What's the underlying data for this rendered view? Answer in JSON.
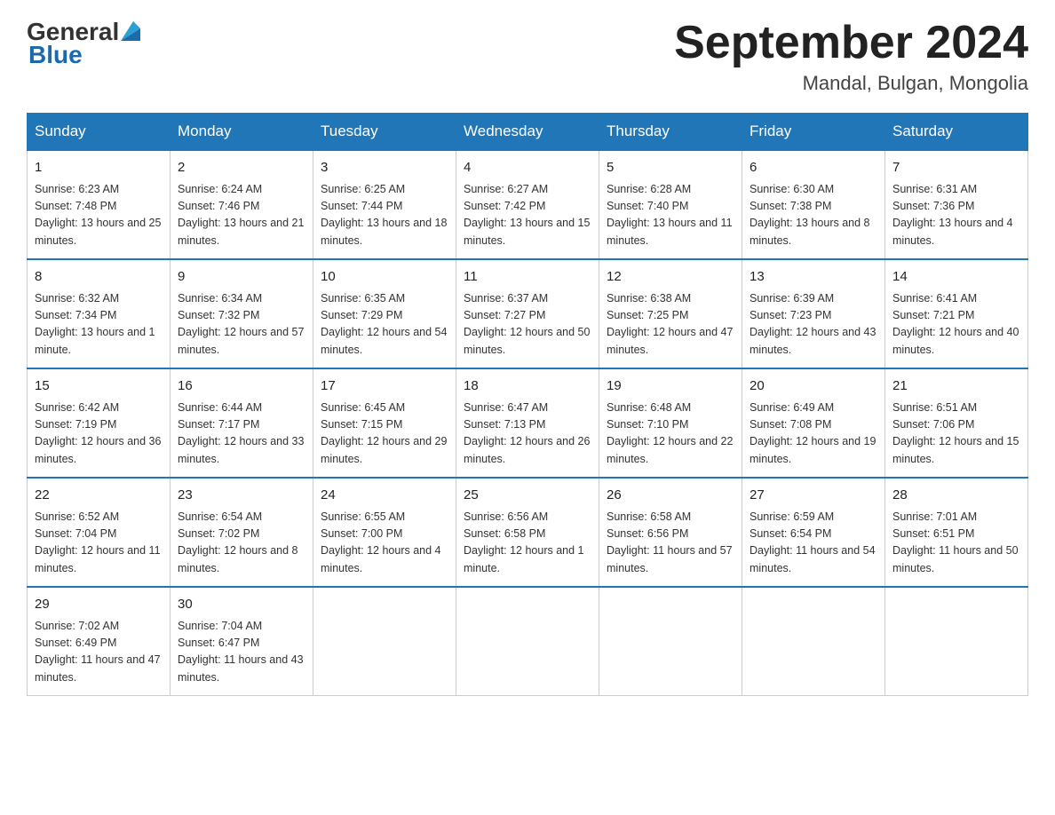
{
  "header": {
    "logo_general": "General",
    "logo_blue": "Blue",
    "month_title": "September 2024",
    "location": "Mandal, Bulgan, Mongolia"
  },
  "weekdays": [
    "Sunday",
    "Monday",
    "Tuesday",
    "Wednesday",
    "Thursday",
    "Friday",
    "Saturday"
  ],
  "weeks": [
    [
      {
        "day": "1",
        "sunrise": "6:23 AM",
        "sunset": "7:48 PM",
        "daylight": "13 hours and 25 minutes."
      },
      {
        "day": "2",
        "sunrise": "6:24 AM",
        "sunset": "7:46 PM",
        "daylight": "13 hours and 21 minutes."
      },
      {
        "day": "3",
        "sunrise": "6:25 AM",
        "sunset": "7:44 PM",
        "daylight": "13 hours and 18 minutes."
      },
      {
        "day": "4",
        "sunrise": "6:27 AM",
        "sunset": "7:42 PM",
        "daylight": "13 hours and 15 minutes."
      },
      {
        "day": "5",
        "sunrise": "6:28 AM",
        "sunset": "7:40 PM",
        "daylight": "13 hours and 11 minutes."
      },
      {
        "day": "6",
        "sunrise": "6:30 AM",
        "sunset": "7:38 PM",
        "daylight": "13 hours and 8 minutes."
      },
      {
        "day": "7",
        "sunrise": "6:31 AM",
        "sunset": "7:36 PM",
        "daylight": "13 hours and 4 minutes."
      }
    ],
    [
      {
        "day": "8",
        "sunrise": "6:32 AM",
        "sunset": "7:34 PM",
        "daylight": "13 hours and 1 minute."
      },
      {
        "day": "9",
        "sunrise": "6:34 AM",
        "sunset": "7:32 PM",
        "daylight": "12 hours and 57 minutes."
      },
      {
        "day": "10",
        "sunrise": "6:35 AM",
        "sunset": "7:29 PM",
        "daylight": "12 hours and 54 minutes."
      },
      {
        "day": "11",
        "sunrise": "6:37 AM",
        "sunset": "7:27 PM",
        "daylight": "12 hours and 50 minutes."
      },
      {
        "day": "12",
        "sunrise": "6:38 AM",
        "sunset": "7:25 PM",
        "daylight": "12 hours and 47 minutes."
      },
      {
        "day": "13",
        "sunrise": "6:39 AM",
        "sunset": "7:23 PM",
        "daylight": "12 hours and 43 minutes."
      },
      {
        "day": "14",
        "sunrise": "6:41 AM",
        "sunset": "7:21 PM",
        "daylight": "12 hours and 40 minutes."
      }
    ],
    [
      {
        "day": "15",
        "sunrise": "6:42 AM",
        "sunset": "7:19 PM",
        "daylight": "12 hours and 36 minutes."
      },
      {
        "day": "16",
        "sunrise": "6:44 AM",
        "sunset": "7:17 PM",
        "daylight": "12 hours and 33 minutes."
      },
      {
        "day": "17",
        "sunrise": "6:45 AM",
        "sunset": "7:15 PM",
        "daylight": "12 hours and 29 minutes."
      },
      {
        "day": "18",
        "sunrise": "6:47 AM",
        "sunset": "7:13 PM",
        "daylight": "12 hours and 26 minutes."
      },
      {
        "day": "19",
        "sunrise": "6:48 AM",
        "sunset": "7:10 PM",
        "daylight": "12 hours and 22 minutes."
      },
      {
        "day": "20",
        "sunrise": "6:49 AM",
        "sunset": "7:08 PM",
        "daylight": "12 hours and 19 minutes."
      },
      {
        "day": "21",
        "sunrise": "6:51 AM",
        "sunset": "7:06 PM",
        "daylight": "12 hours and 15 minutes."
      }
    ],
    [
      {
        "day": "22",
        "sunrise": "6:52 AM",
        "sunset": "7:04 PM",
        "daylight": "12 hours and 11 minutes."
      },
      {
        "day": "23",
        "sunrise": "6:54 AM",
        "sunset": "7:02 PM",
        "daylight": "12 hours and 8 minutes."
      },
      {
        "day": "24",
        "sunrise": "6:55 AM",
        "sunset": "7:00 PM",
        "daylight": "12 hours and 4 minutes."
      },
      {
        "day": "25",
        "sunrise": "6:56 AM",
        "sunset": "6:58 PM",
        "daylight": "12 hours and 1 minute."
      },
      {
        "day": "26",
        "sunrise": "6:58 AM",
        "sunset": "6:56 PM",
        "daylight": "11 hours and 57 minutes."
      },
      {
        "day": "27",
        "sunrise": "6:59 AM",
        "sunset": "6:54 PM",
        "daylight": "11 hours and 54 minutes."
      },
      {
        "day": "28",
        "sunrise": "7:01 AM",
        "sunset": "6:51 PM",
        "daylight": "11 hours and 50 minutes."
      }
    ],
    [
      {
        "day": "29",
        "sunrise": "7:02 AM",
        "sunset": "6:49 PM",
        "daylight": "11 hours and 47 minutes."
      },
      {
        "day": "30",
        "sunrise": "7:04 AM",
        "sunset": "6:47 PM",
        "daylight": "11 hours and 43 minutes."
      },
      null,
      null,
      null,
      null,
      null
    ]
  ]
}
